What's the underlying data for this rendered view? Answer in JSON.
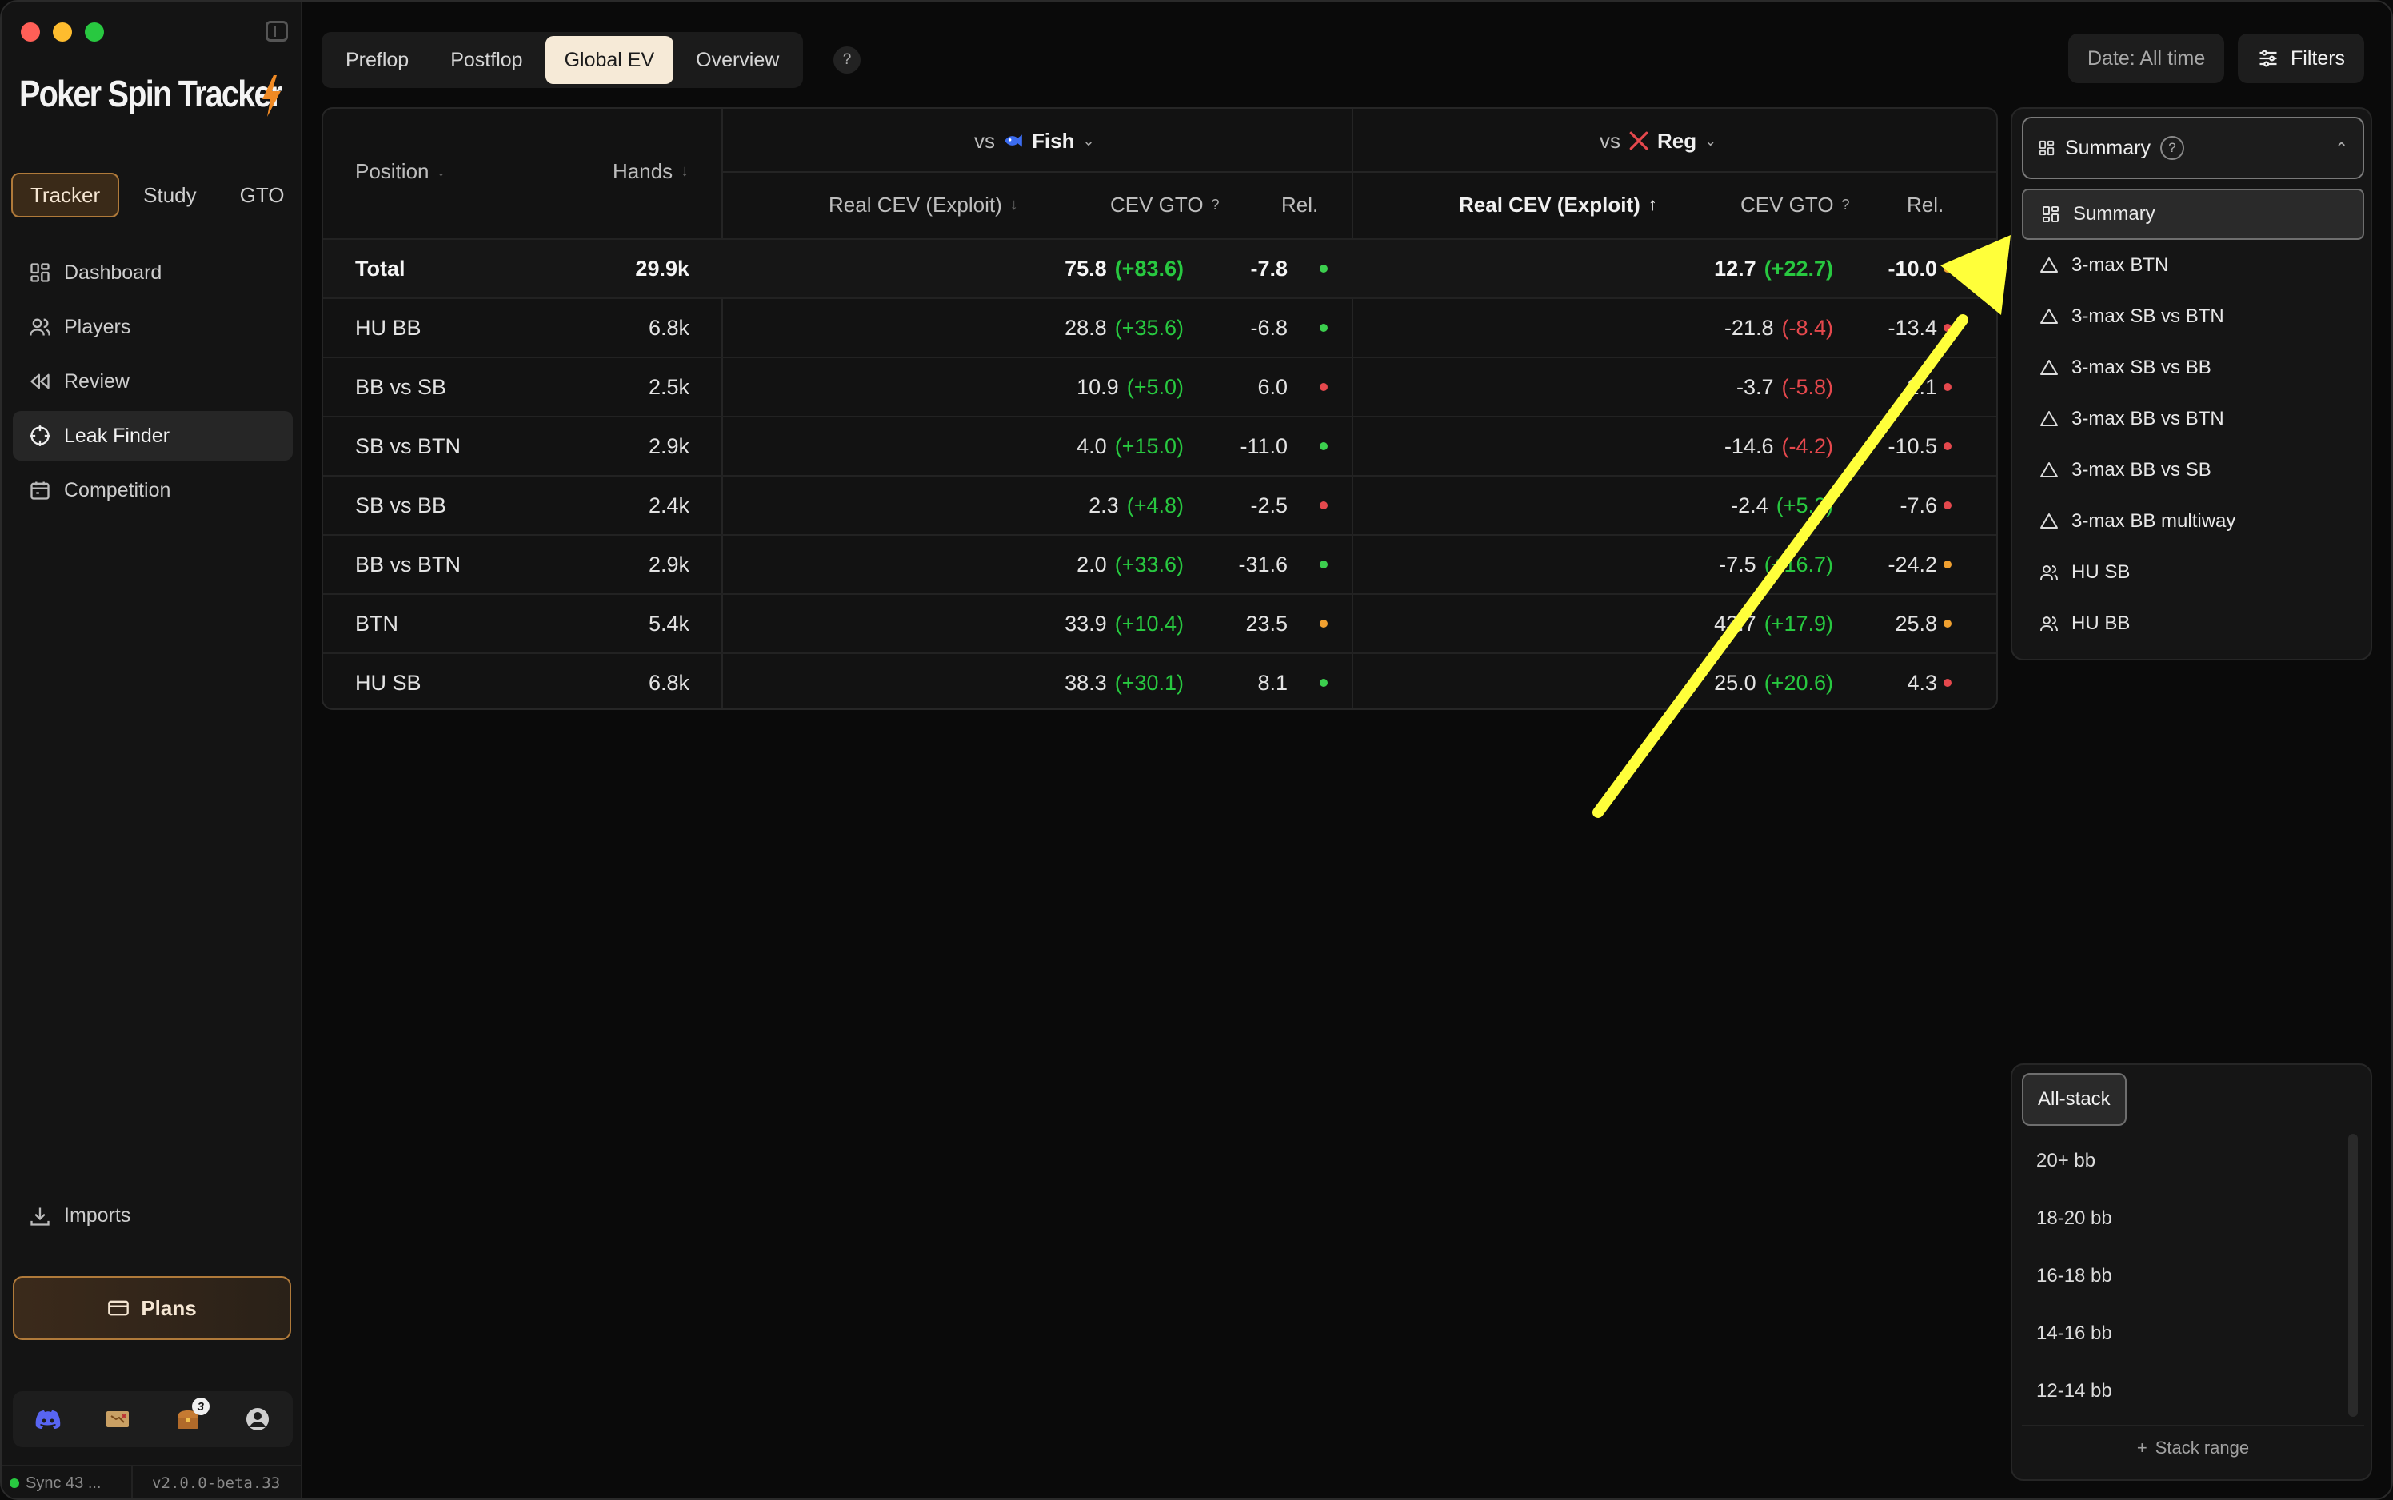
{
  "window": {
    "traffic_lights": [
      "close",
      "minimize",
      "zoom"
    ]
  },
  "sidebar": {
    "logo_text": "Poker Spin Tracker",
    "mode_tabs": [
      {
        "label": "Tracker",
        "active": true
      },
      {
        "label": "Study",
        "active": false
      },
      {
        "label": "GTO",
        "active": false
      }
    ],
    "nav": [
      {
        "label": "Dashboard",
        "icon": "grid-icon",
        "active": false
      },
      {
        "label": "Players",
        "icon": "users-icon",
        "active": false
      },
      {
        "label": "Review",
        "icon": "rewind-icon",
        "active": false
      },
      {
        "label": "Leak Finder",
        "icon": "crosshair-icon",
        "active": true
      },
      {
        "label": "Competition",
        "icon": "calendar-icon",
        "active": false
      }
    ],
    "imports_label": "Imports",
    "plans_label": "Plans",
    "notification_count": "3",
    "status": {
      "sync": "Sync 43 ...",
      "version": "v2.0.0-beta.33"
    }
  },
  "topbar": {
    "tabs": [
      {
        "label": "Preflop",
        "active": false
      },
      {
        "label": "Postflop",
        "active": false
      },
      {
        "label": "Global EV",
        "active": true
      },
      {
        "label": "Overview",
        "active": false
      }
    ],
    "help": "?",
    "date_filter": "Date: All time",
    "filters_label": "Filters"
  },
  "table": {
    "headers": {
      "position": "Position",
      "hands": "Hands",
      "group_fish": "vs",
      "group_fish_name": "Fish",
      "group_reg": "vs",
      "group_reg_name": "Reg",
      "real_cev": "Real CEV (Exploit)",
      "cev_gto": "CEV GTO",
      "help": "?",
      "rel": "Rel."
    },
    "rows": [
      {
        "position": "Total",
        "hands": "29.9k",
        "fish_cev": "75.8",
        "fish_diff": "(+83.6)",
        "fish_diff_sign": "pos",
        "fish_gto": "-7.8",
        "fish_rel": "green",
        "reg_cev": "12.7",
        "reg_diff": "(+22.7)",
        "reg_diff_sign": "pos",
        "reg_gto": "-10.0",
        "reg_rel": "orange"
      },
      {
        "position": "HU BB",
        "hands": "6.8k",
        "fish_cev": "28.8",
        "fish_diff": "(+35.6)",
        "fish_diff_sign": "pos",
        "fish_gto": "-6.8",
        "fish_rel": "green",
        "reg_cev": "-21.8",
        "reg_diff": "(-8.4)",
        "reg_diff_sign": "neg",
        "reg_gto": "-13.4",
        "reg_rel": "red"
      },
      {
        "position": "BB vs SB",
        "hands": "2.5k",
        "fish_cev": "10.9",
        "fish_diff": "(+5.0)",
        "fish_diff_sign": "pos",
        "fish_gto": "6.0",
        "fish_rel": "red",
        "reg_cev": "-3.7",
        "reg_diff": "(-5.8)",
        "reg_diff_sign": "neg",
        "reg_gto": "2.1",
        "reg_rel": "red"
      },
      {
        "position": "SB vs BTN",
        "hands": "2.9k",
        "fish_cev": "4.0",
        "fish_diff": "(+15.0)",
        "fish_diff_sign": "pos",
        "fish_gto": "-11.0",
        "fish_rel": "green",
        "reg_cev": "-14.6",
        "reg_diff": "(-4.2)",
        "reg_diff_sign": "neg",
        "reg_gto": "-10.5",
        "reg_rel": "red"
      },
      {
        "position": "SB vs BB",
        "hands": "2.4k",
        "fish_cev": "2.3",
        "fish_diff": "(+4.8)",
        "fish_diff_sign": "pos",
        "fish_gto": "-2.5",
        "fish_rel": "red",
        "reg_cev": "-2.4",
        "reg_diff": "(+5.2)",
        "reg_diff_sign": "pos",
        "reg_gto": "-7.6",
        "reg_rel": "red"
      },
      {
        "position": "BB vs BTN",
        "hands": "2.9k",
        "fish_cev": "2.0",
        "fish_diff": "(+33.6)",
        "fish_diff_sign": "pos",
        "fish_gto": "-31.6",
        "fish_rel": "green",
        "reg_cev": "-7.5",
        "reg_diff": "(+16.7)",
        "reg_diff_sign": "pos",
        "reg_gto": "-24.2",
        "reg_rel": "orange"
      },
      {
        "position": "BTN",
        "hands": "5.4k",
        "fish_cev": "33.9",
        "fish_diff": "(+10.4)",
        "fish_diff_sign": "pos",
        "fish_gto": "23.5",
        "fish_rel": "orange",
        "reg_cev": "43.7",
        "reg_diff": "(+17.9)",
        "reg_diff_sign": "pos",
        "reg_gto": "25.8",
        "reg_rel": "orange"
      },
      {
        "position": "HU SB",
        "hands": "6.8k",
        "fish_cev": "38.3",
        "fish_diff": "(+30.1)",
        "fish_diff_sign": "pos",
        "fish_gto": "8.1",
        "fish_rel": "green",
        "reg_cev": "25.0",
        "reg_diff": "(+20.6)",
        "reg_diff_sign": "pos",
        "reg_gto": "4.3",
        "reg_rel": "red"
      }
    ]
  },
  "summary_dropdown": {
    "selected": "Summary",
    "help": "?",
    "options": [
      {
        "label": "Summary",
        "icon": "grid-icon",
        "active": true
      },
      {
        "label": "3-max BTN",
        "icon": "triangle-icon",
        "active": false
      },
      {
        "label": "3-max SB vs BTN",
        "icon": "triangle-icon",
        "active": false
      },
      {
        "label": "3-max SB vs BB",
        "icon": "triangle-icon",
        "active": false
      },
      {
        "label": "3-max BB vs BTN",
        "icon": "triangle-icon",
        "active": false
      },
      {
        "label": "3-max BB vs SB",
        "icon": "triangle-icon",
        "active": false
      },
      {
        "label": "3-max BB multiway",
        "icon": "triangle-icon",
        "active": false
      },
      {
        "label": "HU SB",
        "icon": "users-icon",
        "active": false
      },
      {
        "label": "HU BB",
        "icon": "users-icon",
        "active": false
      }
    ]
  },
  "stack_panel": {
    "active": "All-stack",
    "items": [
      "20+ bb",
      "18-20 bb",
      "16-18 bb",
      "14-16 bb",
      "12-14 bb"
    ],
    "add_label": "Stack range"
  },
  "colors": {
    "accent": "#b07a3a",
    "positive": "#28c840",
    "negative": "#e5484d",
    "warning": "#f0a030",
    "annotation_arrow": "#ffff3a"
  }
}
